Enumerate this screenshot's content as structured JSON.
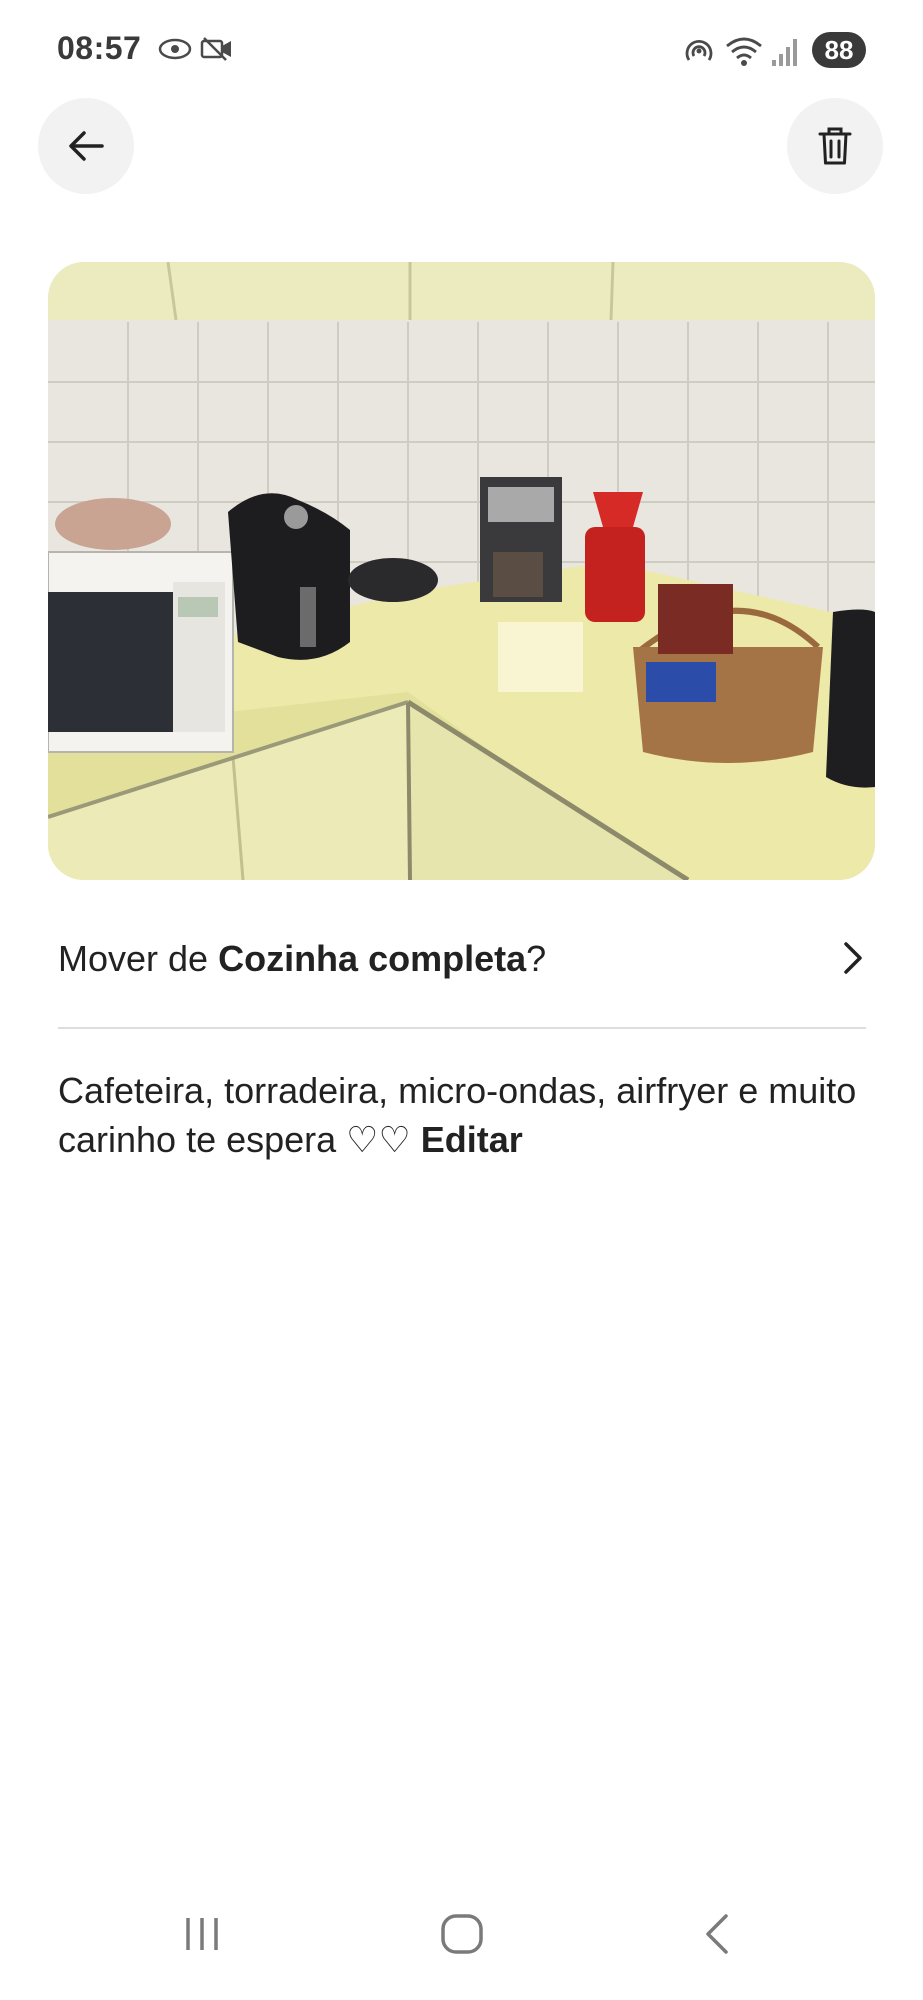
{
  "status_bar": {
    "time": "08:57",
    "battery": "88",
    "left_icons": [
      "eye-icon",
      "video-off-icon"
    ],
    "right_icons": [
      "nfc-icon",
      "wifi-icon",
      "signal-icon"
    ]
  },
  "header": {
    "back_icon": "arrow-left-icon",
    "delete_icon": "trash-icon"
  },
  "photo": {
    "subject": "kitchen-counter-photo"
  },
  "move_row": {
    "prefix": "Mover de ",
    "room": "Cozinha completa",
    "suffix": "?",
    "chevron_icon": "chevron-right-icon"
  },
  "caption": {
    "text": "Cafeteira,  torradeira, micro-ondas,  airfryer e muito carinho te espera ♡♡ ",
    "edit_label": "Editar"
  },
  "nav": {
    "recents_icon": "recents-icon",
    "home_icon": "home-icon",
    "back_icon": "back-icon"
  },
  "colors": {
    "button_bg": "#f2f2f2",
    "text": "#222222",
    "divider": "#dddddd"
  }
}
